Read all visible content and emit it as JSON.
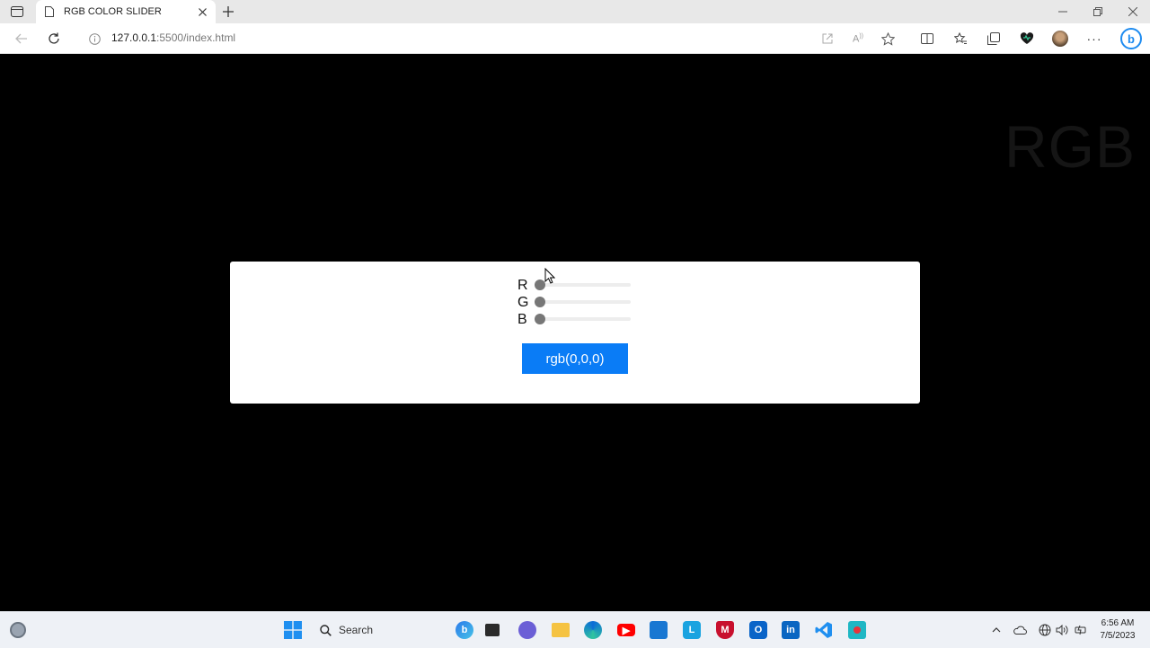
{
  "browser": {
    "tab_title": "RGB COLOR SLIDER",
    "url_host": "127.0.0.1",
    "url_rest": ":5500/index.html"
  },
  "page": {
    "watermark": "RGB",
    "sliders": [
      {
        "label": "R",
        "value": 0,
        "min": 0,
        "max": 255
      },
      {
        "label": "G",
        "value": 0,
        "min": 0,
        "max": 255
      },
      {
        "label": "B",
        "value": 0,
        "min": 0,
        "max": 255
      }
    ],
    "rgb_button": "rgb(0,0,0)",
    "colors": {
      "button": "#0a7cf6",
      "background": "#000000",
      "card": "#ffffff"
    }
  },
  "taskbar": {
    "search_label": "Search",
    "time": "6:56 AM",
    "date": "7/5/2023",
    "pinned": [
      "copilot-icon",
      "file-explorer-icon",
      "teams-icon",
      "folder-icon",
      "edge-icon",
      "youtube-icon",
      "store-icon",
      "l-app-icon",
      "mcafee-icon",
      "outlook-icon",
      "linkedin-icon",
      "vscode-icon",
      "screen-recorder-icon"
    ]
  }
}
